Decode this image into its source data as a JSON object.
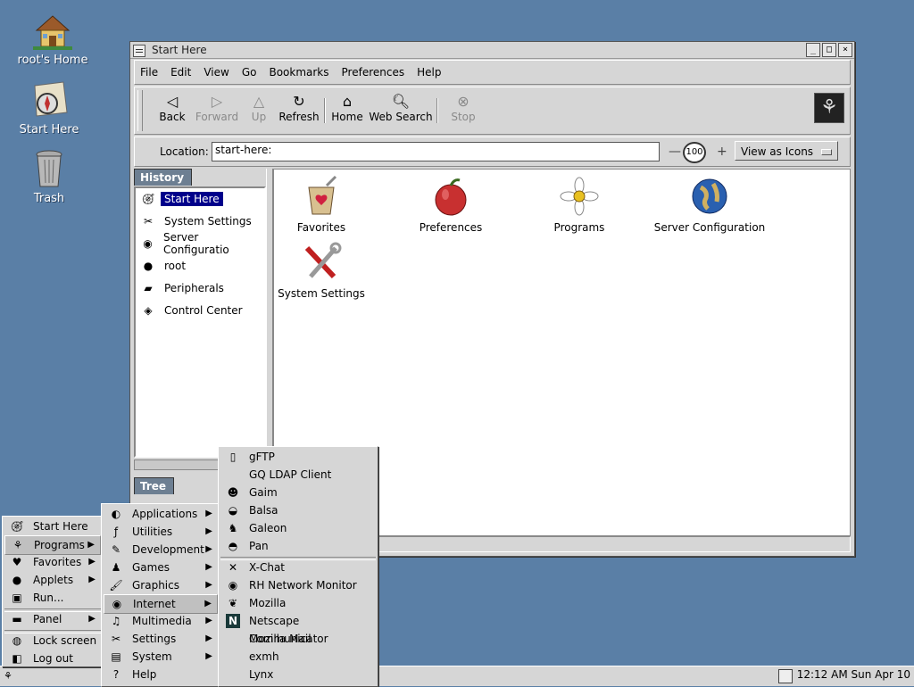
{
  "desktop": {
    "icons": [
      {
        "label": "root's Home"
      },
      {
        "label": "Start Here"
      },
      {
        "label": "Trash"
      }
    ]
  },
  "window": {
    "title": "Start Here",
    "menubar": [
      "File",
      "Edit",
      "View",
      "Go",
      "Bookmarks",
      "Preferences",
      "Help"
    ],
    "toolbar": {
      "back": "Back",
      "forward": "Forward",
      "up": "Up",
      "refresh": "Refresh",
      "home": "Home",
      "web_search": "Web Search",
      "stop": "Stop"
    },
    "location": {
      "label": "Location:",
      "value": "start-here:",
      "zoom": "100",
      "view_as": "View as Icons"
    },
    "sidebar": {
      "history_tab": "History",
      "tree_tab": "Tree",
      "history_items": [
        "Start Here",
        "System Settings",
        "Server Configuratio",
        "root",
        "Peripherals",
        "Control Center"
      ]
    },
    "content_icons": [
      "Favorites",
      "Preferences",
      "Programs",
      "Server Configuration",
      "System Settings"
    ]
  },
  "menus": {
    "main": [
      "Start Here",
      "Programs",
      "Favorites",
      "Applets",
      "Run...",
      "Panel",
      "Lock screen",
      "Log out"
    ],
    "programs": [
      "Applications",
      "Utilities",
      "Development",
      "Games",
      "Graphics",
      "Internet",
      "Multimedia",
      "Settings",
      "System",
      "Help"
    ],
    "internet": [
      "gFTP",
      "GQ LDAP Client",
      "Gaim",
      "Balsa",
      "Galeon",
      "Pan",
      "X-Chat",
      "RH Network Monitor",
      "Mozilla",
      "Netscape Communicator",
      "Mozilla Mail",
      "exmh",
      "Lynx"
    ]
  },
  "panel": {
    "clock": "12:12 AM Sun Apr 10"
  },
  "colors": {
    "desktop": "#5a7fa6",
    "selection": "#00008b",
    "tab": "#6d7f92"
  }
}
